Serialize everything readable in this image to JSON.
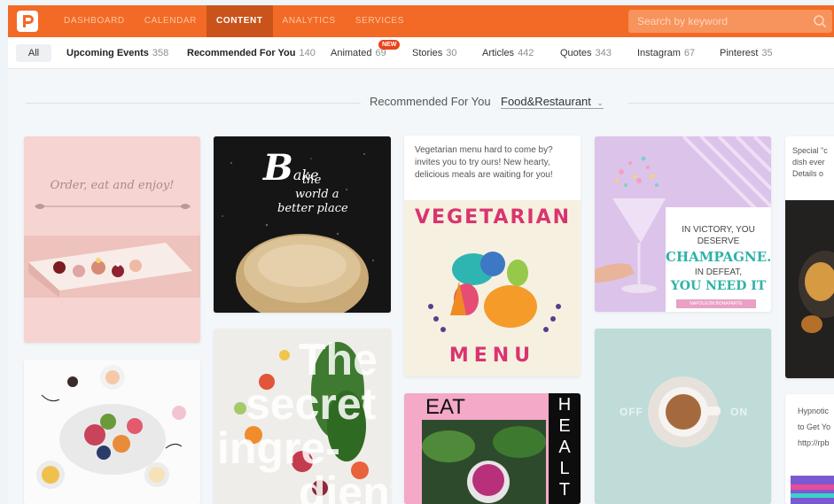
{
  "nav": {
    "items": [
      "DASHBOARD",
      "CALENDAR",
      "CONTENT",
      "ANALYTICS",
      "SERVICES"
    ],
    "active": "CONTENT"
  },
  "search": {
    "placeholder": "Search by keyword"
  },
  "tabs": [
    {
      "label": "All",
      "count": ""
    },
    {
      "label": "Upcoming Events",
      "count": "358"
    },
    {
      "label": "Recommended For You",
      "count": "140"
    },
    {
      "label": "Animated",
      "count": "69",
      "badge": "NEW"
    },
    {
      "label": "Stories",
      "count": "30"
    },
    {
      "label": "Articles",
      "count": "442"
    },
    {
      "label": "Quotes",
      "count": "343"
    },
    {
      "label": "Instagram",
      "count": "67"
    },
    {
      "label": "Pinterest",
      "count": "35"
    }
  ],
  "filter": {
    "label": "Recommended For You",
    "selected": "Food&Restaurant"
  },
  "cards": {
    "order": {
      "text": "Order, eat and enjoy!"
    },
    "bake": {
      "big": "B",
      "rest": "ake",
      "lines": [
        "the",
        "world a",
        "better place"
      ]
    },
    "veg": {
      "caption": "Vegetarian menu hard to come by? invites you to try ours! New hearty, delicious meals are waiting for you!",
      "top": "VEGETARIAN",
      "bottom": "MENU"
    },
    "champ": {
      "line1": "IN VICTORY, YOU",
      "line2": "DESERVE",
      "line3": "CHAMPAGNE.",
      "line4": "IN DEFEAT,",
      "line5": "YOU NEED IT",
      "author": "NAPOLEON BONAPARTE"
    },
    "special": {
      "caption": "Special \"c dish ever Details o"
    },
    "secret": {
      "l1": "The",
      "l2": "secret",
      "l3": "ingre-",
      "l4": "dient"
    },
    "eat": {
      "left": "EAT",
      "right": [
        "H",
        "E",
        "A",
        "L",
        "T"
      ]
    },
    "coffee": {
      "off": "OFF",
      "on": "ON"
    },
    "hypnotic": {
      "l1": "Hypnotic",
      "l2": "to Get Yo",
      "l3": "http://rpb"
    },
    "food": {}
  },
  "colors": {
    "brand": "#f26a26",
    "active_nav": "#c9531b"
  }
}
